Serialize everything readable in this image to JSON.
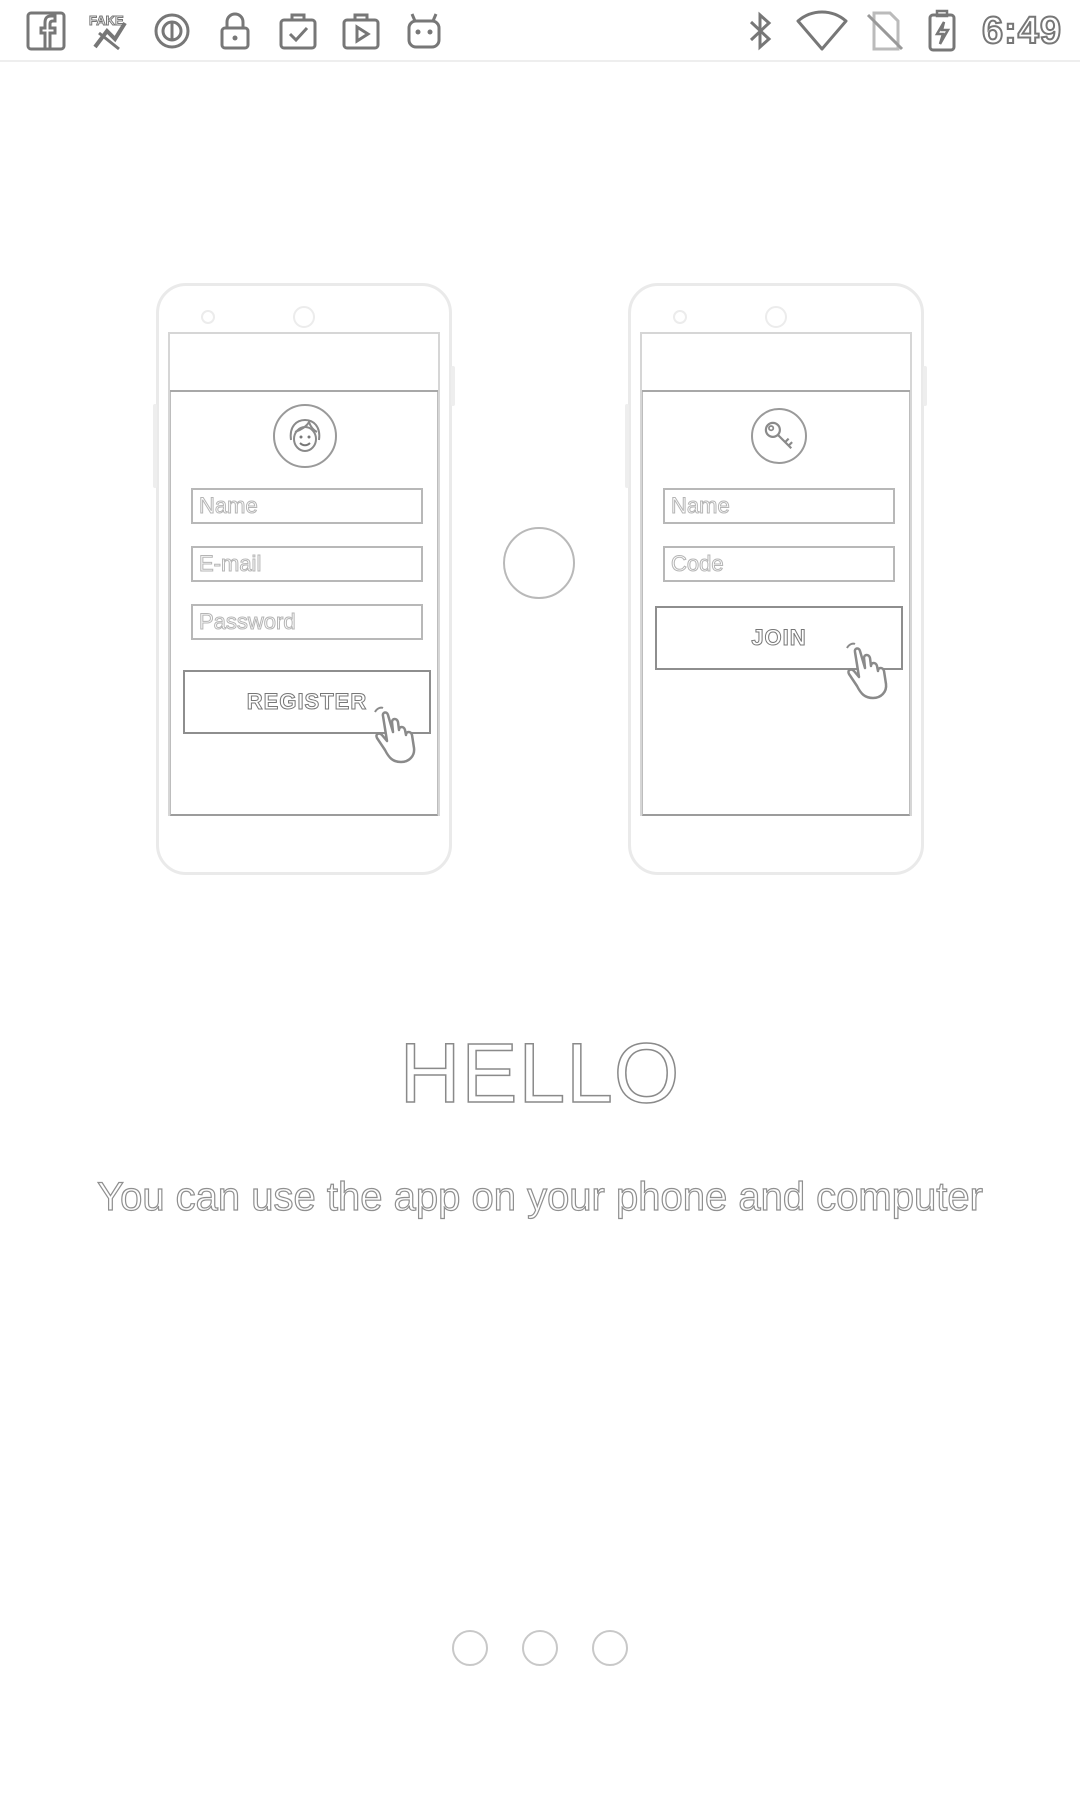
{
  "status_bar": {
    "left_icons": [
      "facebook-icon",
      "fake-gps-icon",
      "circle-notification-icon",
      "lock-icon",
      "clipboard-check-icon",
      "play-store-icon",
      "android-robot-icon"
    ],
    "right_icons": [
      "bluetooth-icon",
      "wifi-icon",
      "no-sim-icon",
      "battery-charging-icon"
    ],
    "time": "6:49"
  },
  "illustration": {
    "left_phone": {
      "fields": [
        {
          "label": "Name"
        },
        {
          "label": "E-mail"
        },
        {
          "label": "Password"
        }
      ],
      "button": "REGISTER"
    },
    "right_phone": {
      "fields": [
        {
          "label": "Name"
        },
        {
          "label": "Code"
        }
      ],
      "button": "JOIN"
    }
  },
  "onboarding": {
    "title": "HELLO",
    "subtitle": "You can use the app on your phone and computer"
  },
  "pager": {
    "count": 3,
    "active_index": 0
  }
}
